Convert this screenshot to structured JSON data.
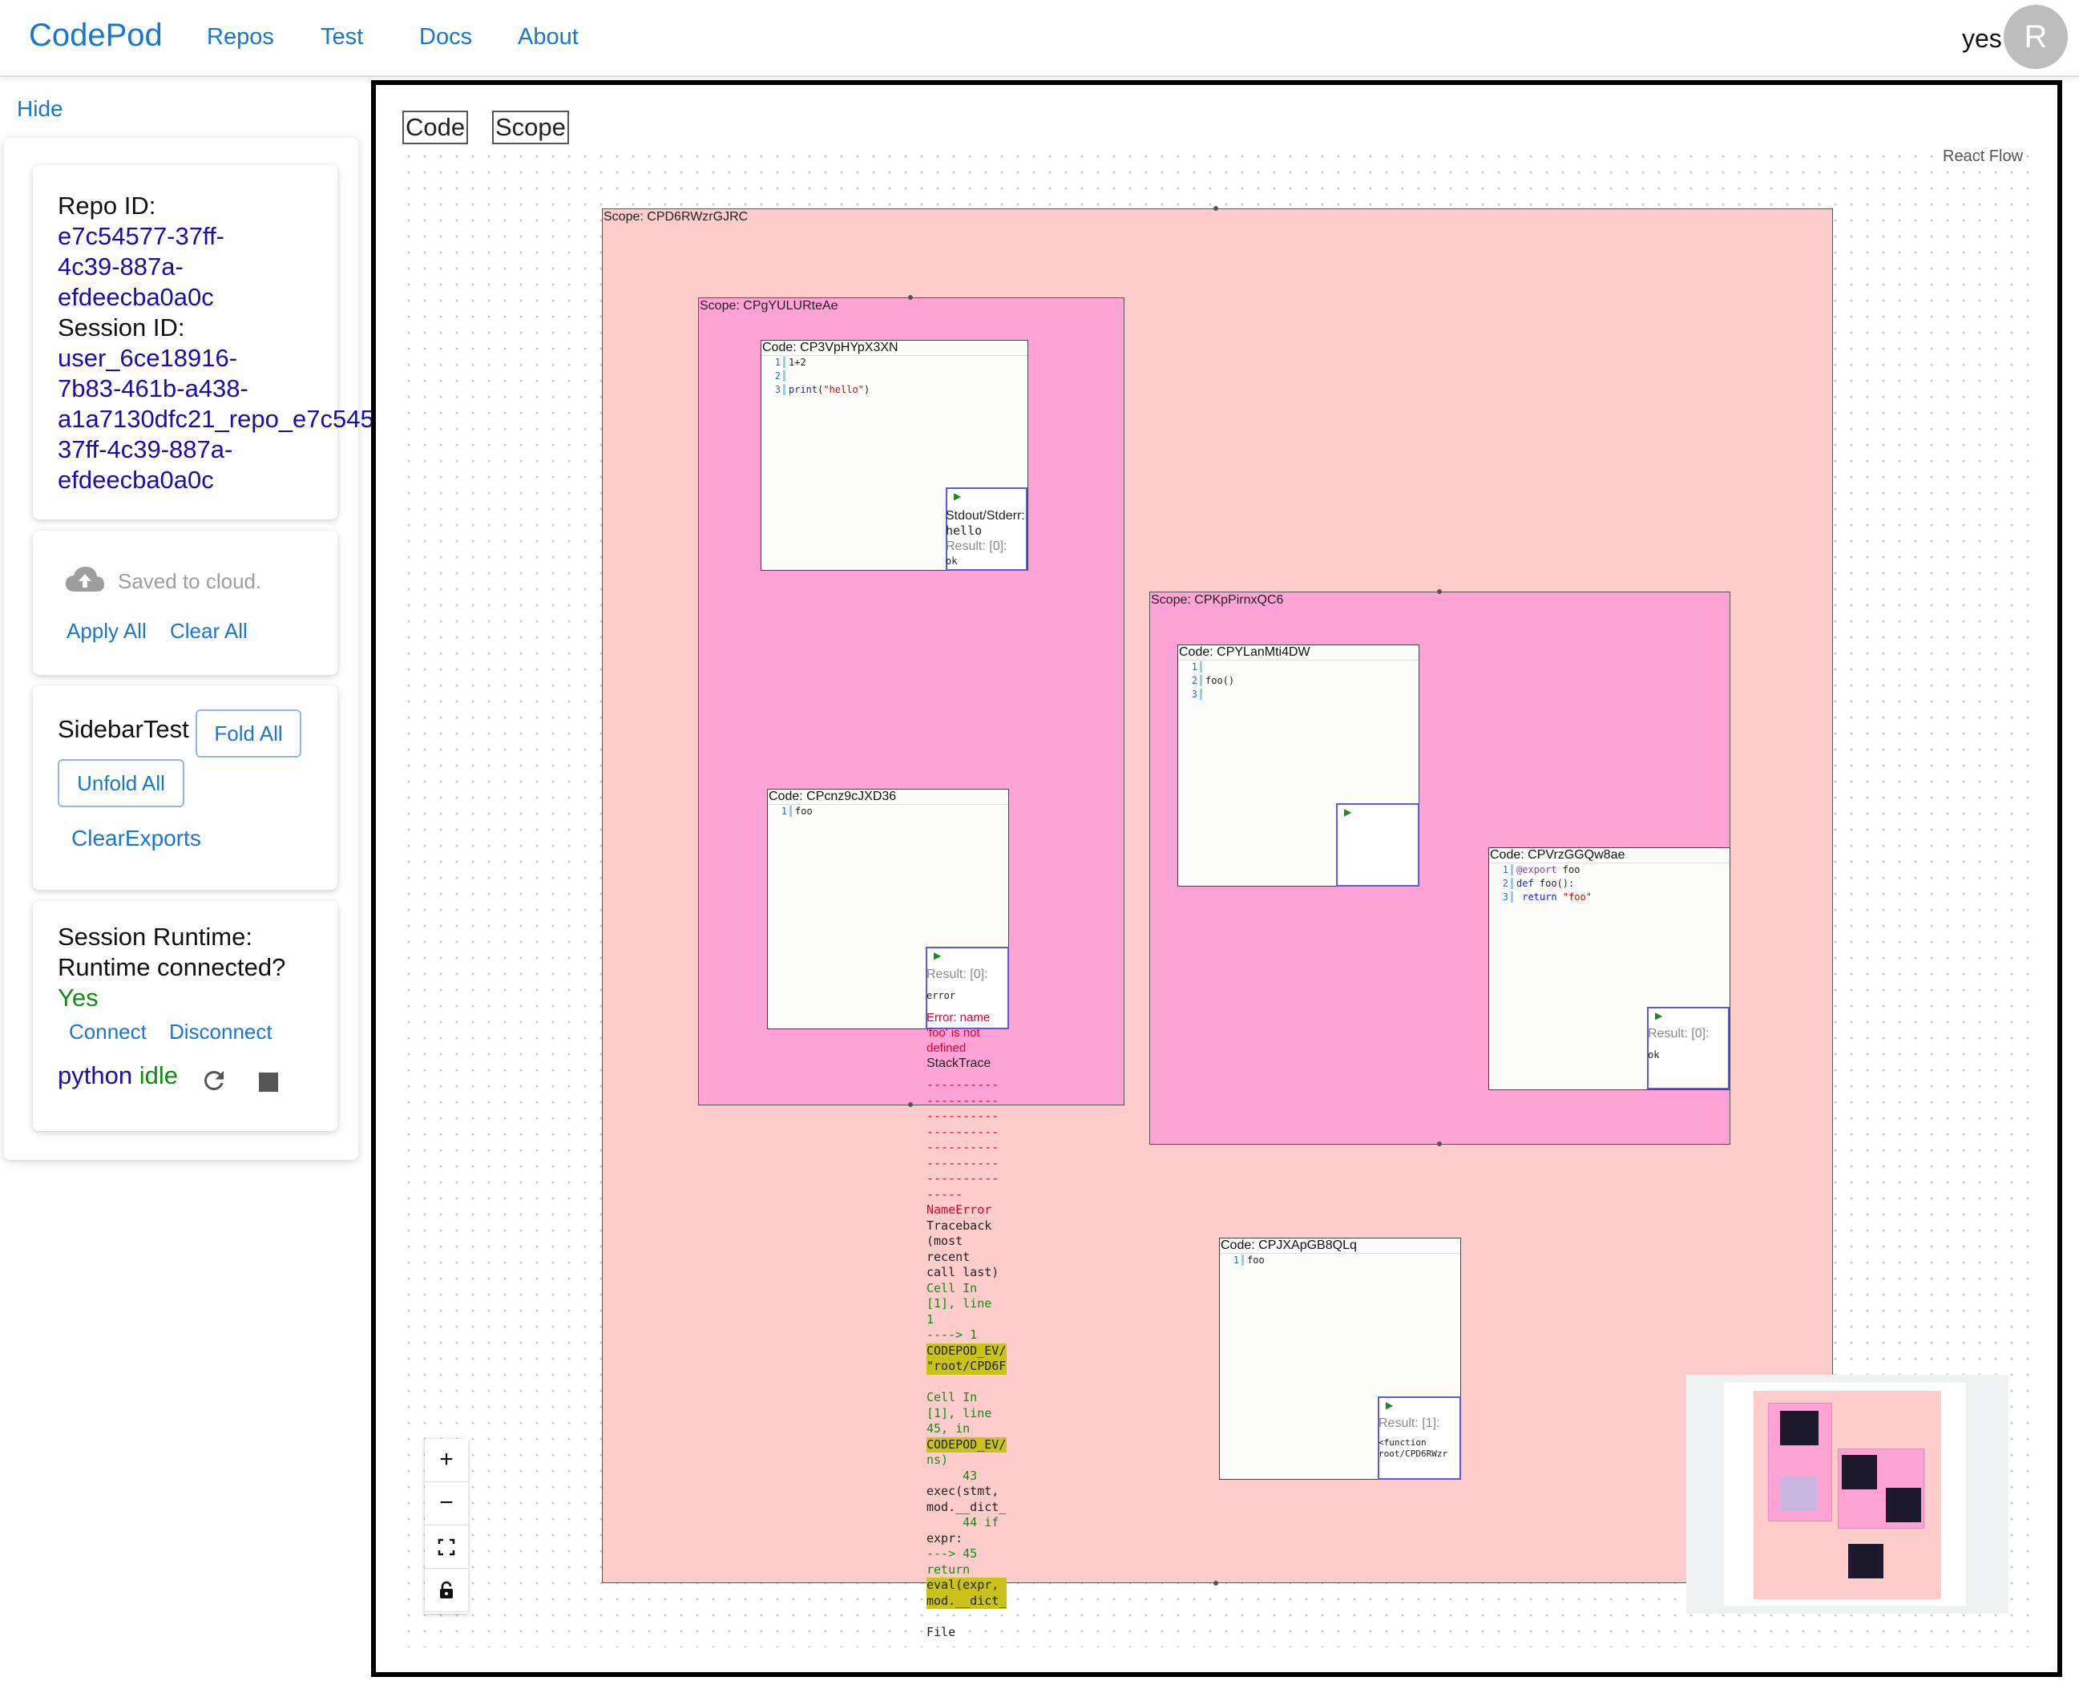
{
  "appbar": {
    "brand": "CodePod",
    "nav": [
      "Repos",
      "Test",
      "Docs",
      "About"
    ],
    "user_text": "yes",
    "avatar_letter": "R"
  },
  "sidebar": {
    "hide_label": "Hide",
    "repo": {
      "repo_id_label": "Repo ID:",
      "repo_id_lines": [
        "e7c54577-37ff-",
        "4c39-887a-",
        "efdeecba0a0c"
      ],
      "session_id_label": "Session ID:",
      "session_id_lines": [
        "user_6ce18916-",
        "7b83-461b-a438-",
        "a1a7130dfc21_repo_e7c545",
        "37ff-4c39-887a-",
        "efdeecba0a0c"
      ]
    },
    "save": {
      "status": "Saved to cloud.",
      "apply_all": "Apply All",
      "clear_all": "Clear All"
    },
    "test": {
      "title": "SidebarTest",
      "fold_all": "Fold All",
      "unfold_all": "Unfold All",
      "clear_exports": "ClearExports"
    },
    "runtime": {
      "title": "Session Runtime:",
      "question": "Runtime connected?",
      "answer": "Yes",
      "connect": "Connect",
      "disconnect": "Disconnect",
      "kernel_lang": "python",
      "kernel_status": "idle"
    }
  },
  "canvas": {
    "buttons": [
      "Code",
      "Scope"
    ],
    "attribution": "React Flow",
    "scopes": [
      {
        "label": "Scope: CPD6RWzrGJRC"
      },
      {
        "label": "Scope: CPgYULURteAe"
      },
      {
        "label": "Scope: CPKpPirnxQC6"
      }
    ],
    "pods": [
      {
        "label": "Code: CP3VpHYpX3XN",
        "lines": [
          "1+2",
          "",
          "print(\"hello\")"
        ],
        "result": {
          "stdout_label": "Stdout/Stderr:",
          "stdout": "hello",
          "result_label": "Result: [0]:",
          "result": "ok"
        }
      },
      {
        "label": "Code: CPcnz9cJXD36",
        "lines": [
          "foo"
        ],
        "result": {
          "result_label": "Result: [0]:",
          "result": "error",
          "error": "Error: name 'foo' is not defined",
          "stacktrace_label": "StackTrace"
        }
      },
      {
        "label": "Code: CPYLanMti4DW",
        "lines": [
          "",
          "foo()",
          ""
        ]
      },
      {
        "label": "Code: CPVrzGGQw8ae",
        "lines": [
          "@export foo",
          "def foo():",
          "    return \"foo\""
        ],
        "result": {
          "result_label": "Result: [0]:",
          "result": "ok"
        }
      },
      {
        "label": "Code: CPJXApGB8QLq",
        "lines": [
          "foo"
        ],
        "result": {
          "result_label": "Result: [1]:",
          "result": "<function root/CPD6RWzr"
        }
      }
    ],
    "traceback": [
      "NameError",
      "Traceback",
      "(most",
      "recent",
      "call last)",
      "Cell In",
      "[1], line",
      "1",
      "----> 1",
      "CODEPOD_EV/",
      "\"root/CPD6F",
      "",
      "Cell In",
      "[1], line",
      "45, in",
      "CODEPOD_EV/",
      "ns)",
      "     43",
      "exec(stmt,",
      "mod.__dict_",
      "     44 if",
      "expr:",
      "---> 45",
      "return",
      "eval(expr,",
      "mod.__dict_",
      "",
      "File"
    ]
  },
  "colors": {
    "accent": "#1976d2",
    "link": "#1a0dab",
    "outer_scope": "#ffcccc",
    "inner_scope": "#ffa3d7",
    "result_border": "#5b5bd6",
    "ok_green": "#138a13",
    "error_red": "#e3002b"
  },
  "icons": [
    "cloud-icon",
    "refresh-icon",
    "stop-icon",
    "zoom-in-icon",
    "zoom-out-icon",
    "fit-view-icon",
    "lock-icon",
    "play-icon"
  ]
}
